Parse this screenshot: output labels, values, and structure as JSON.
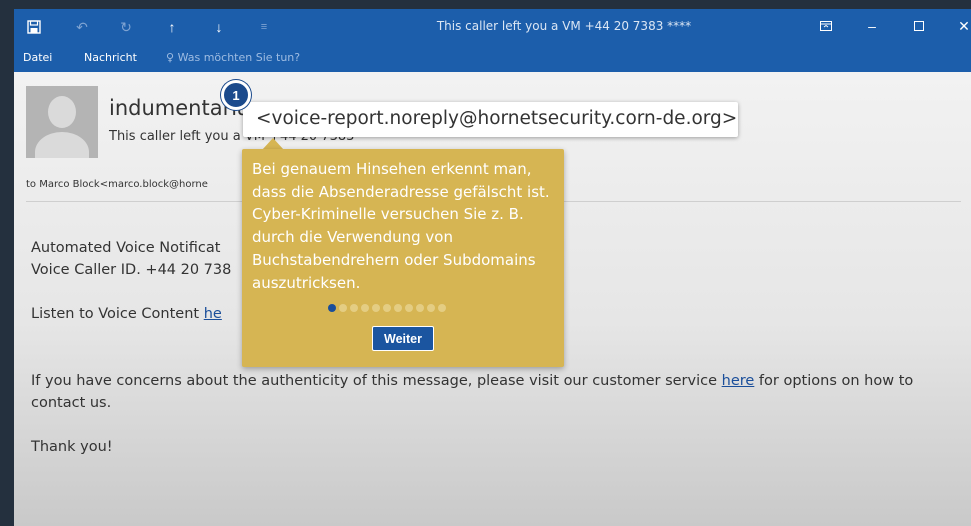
{
  "window": {
    "title": "This caller left you a VM +44 20 7383 ****"
  },
  "quick_access": {
    "save_icon": "save-icon",
    "undo_icon": "undo-icon",
    "redo_icon": "redo-icon",
    "up_icon": "arrow-up-icon",
    "down_icon": "arrow-down-icon",
    "customize_icon": "customize-icon"
  },
  "ribbon": {
    "tabs": [
      "Datei",
      "Nachricht"
    ],
    "tell_me": "Was möchten Sie tun?"
  },
  "message": {
    "sender_name": "indumentaria",
    "subject": "This caller left you a VM +44 20 7383 ****",
    "to_line": "to Marco Block<marco.block@horne",
    "body": {
      "line1": "Automated Voice Notificat",
      "line2": "Voice Caller ID. +44 20 738",
      "listen_prefix": "Listen to Voice Content ",
      "listen_link": "he",
      "concerns_prefix": "If you have concerns about the authenticity of this message, please visit our customer service ",
      "concerns_link": "here",
      "concerns_suffix": " for options on how to",
      "concerns_line2": "contact us.",
      "thanks": "Thank you!"
    }
  },
  "callout": {
    "email_address": "<voice-report.noreply@hornetsecurity.corn-de.org>",
    "step_number": "1"
  },
  "tooltip": {
    "text": "Bei genauem Hinsehen erkennt man, dass die Absenderadresse gefälscht ist. Cyber-Kriminelle versuchen Sie z. B. durch die Verwendung von Buchstabendrehern oder Subdomains auszutricksen.",
    "current_step": 1,
    "total_steps": 11,
    "next_label": "Weiter"
  },
  "colors": {
    "titlebar": "#1c5eab",
    "tooltip_bg": "#d6b553",
    "accent": "#1b4a8c"
  }
}
